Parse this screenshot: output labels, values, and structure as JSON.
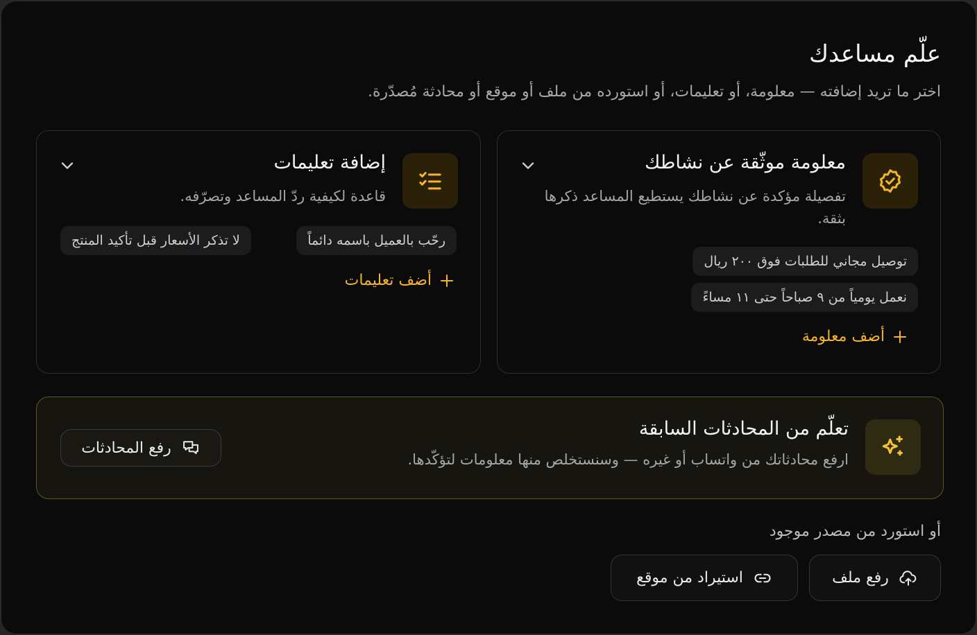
{
  "header": {
    "title": "علّم مساعدك",
    "subtitle": "اختر ما تريد إضافته — معلومة، أو تعليمات، أو استورده من ملف أو موقع أو محادثة مُصدّرة."
  },
  "facts_card": {
    "icon": "verified-badge-icon",
    "title": "معلومة موثّقة عن نشاطك",
    "description": "تفصيلة مؤكدة عن نشاطك يستطيع المساعد ذكرها بثقة.",
    "chips": [
      "توصيل مجاني للطلبات فوق ٢٠٠ ريال",
      "نعمل يومياً من ٩ صباحاً حتى ١١ مساءً"
    ],
    "add_label": "أضف معلومة"
  },
  "instructions_card": {
    "icon": "checklist-icon",
    "title": "إضافة تعليمات",
    "description": "قاعدة لكيفية ردّ المساعد وتصرّفه.",
    "chips": [
      "رحّب بالعميل باسمه دائماً",
      "لا تذكر الأسعار قبل تأكيد المنتج"
    ],
    "add_label": "أضف تعليمات"
  },
  "learn_card": {
    "icon": "sparkles-icon",
    "title": "تعلّم من المحادثات السابقة",
    "description": "ارفع محادثاتك من واتساب أو غيره — وسنستخلص منها معلومات لتؤكّدها.",
    "button_label": "رفع المحادثات",
    "button_icon": "chat-bubbles-icon"
  },
  "import": {
    "heading": "أو استورد من مصدر موجود",
    "upload_file_label": "رفع ملف",
    "upload_file_icon": "cloud-upload-icon",
    "import_site_label": "استيراد من موقع",
    "import_site_icon": "link-icon"
  },
  "colors": {
    "accent": "#f5b52a",
    "background": "#0b0b0b",
    "card_border": "#2e2e2e",
    "learn_border": "#5b5520"
  }
}
